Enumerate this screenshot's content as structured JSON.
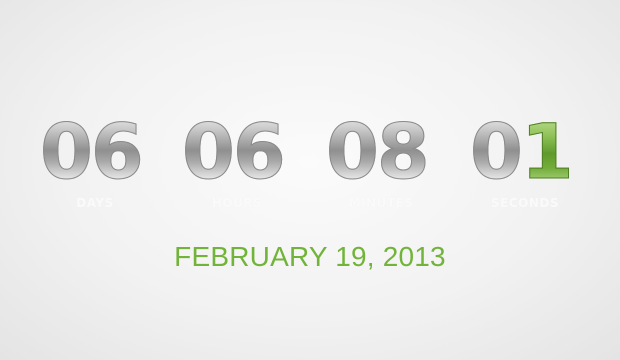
{
  "countdown": {
    "units": [
      {
        "id": "days",
        "digits": [
          "0",
          "6"
        ],
        "label": "DAYS"
      },
      {
        "id": "hours",
        "digits": [
          "0",
          "6"
        ],
        "label": "HOURS"
      },
      {
        "id": "minutes",
        "digits": [
          "0",
          "8"
        ],
        "label": "MINUTES"
      },
      {
        "id": "seconds",
        "digits": [
          "0",
          "1"
        ],
        "label": "SECONDS"
      }
    ],
    "date": "FEBRUARY 19, 2013"
  },
  "colors": {
    "accent": "#72b43a",
    "digit_silver": "#a8a8a8",
    "background": "#f4f4f4"
  }
}
